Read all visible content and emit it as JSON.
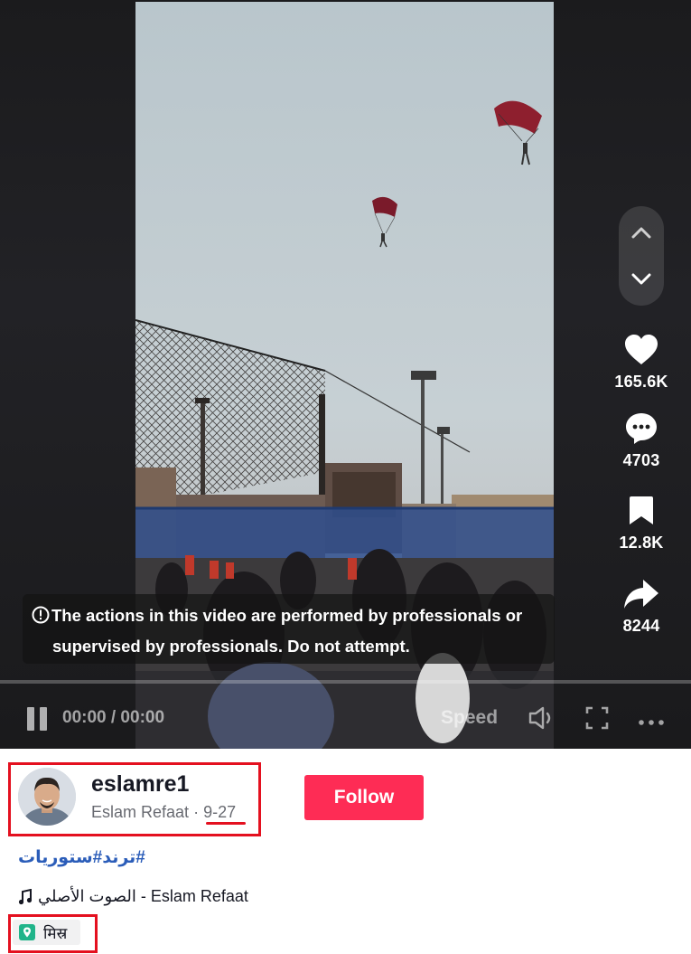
{
  "video": {
    "warning_text_1": "The actions in this video are performed by professionals or",
    "warning_text_2": "supervised by professionals. Do not attempt.",
    "progress": 0,
    "time": "00:00 / 00:00",
    "speed_label": "Speed"
  },
  "actions": {
    "likes": "165.6K",
    "comments": "4703",
    "saves": "12.8K",
    "shares": "8244"
  },
  "author": {
    "handle": "eslamre1",
    "display_name": "Eslam Refaat",
    "separator": "·",
    "date": "9-27"
  },
  "follow_label": "Follow",
  "hashtags": [
    "#ترند",
    "#ستوريات"
  ],
  "music": "الصوت الأصلي - Eslam Refaat",
  "location": "मिस्र",
  "colors": {
    "follow": "#fe2c55",
    "hashtag": "#2b5db9",
    "highlight_box": "#e4101f"
  },
  "icons": [
    "chevron-up-icon",
    "chevron-down-icon",
    "heart-icon",
    "comment-icon",
    "bookmark-icon",
    "share-icon",
    "info-icon",
    "pause-icon",
    "volume-icon",
    "fullscreen-icon",
    "more-icon",
    "music-note-icon",
    "location-pin-icon"
  ]
}
